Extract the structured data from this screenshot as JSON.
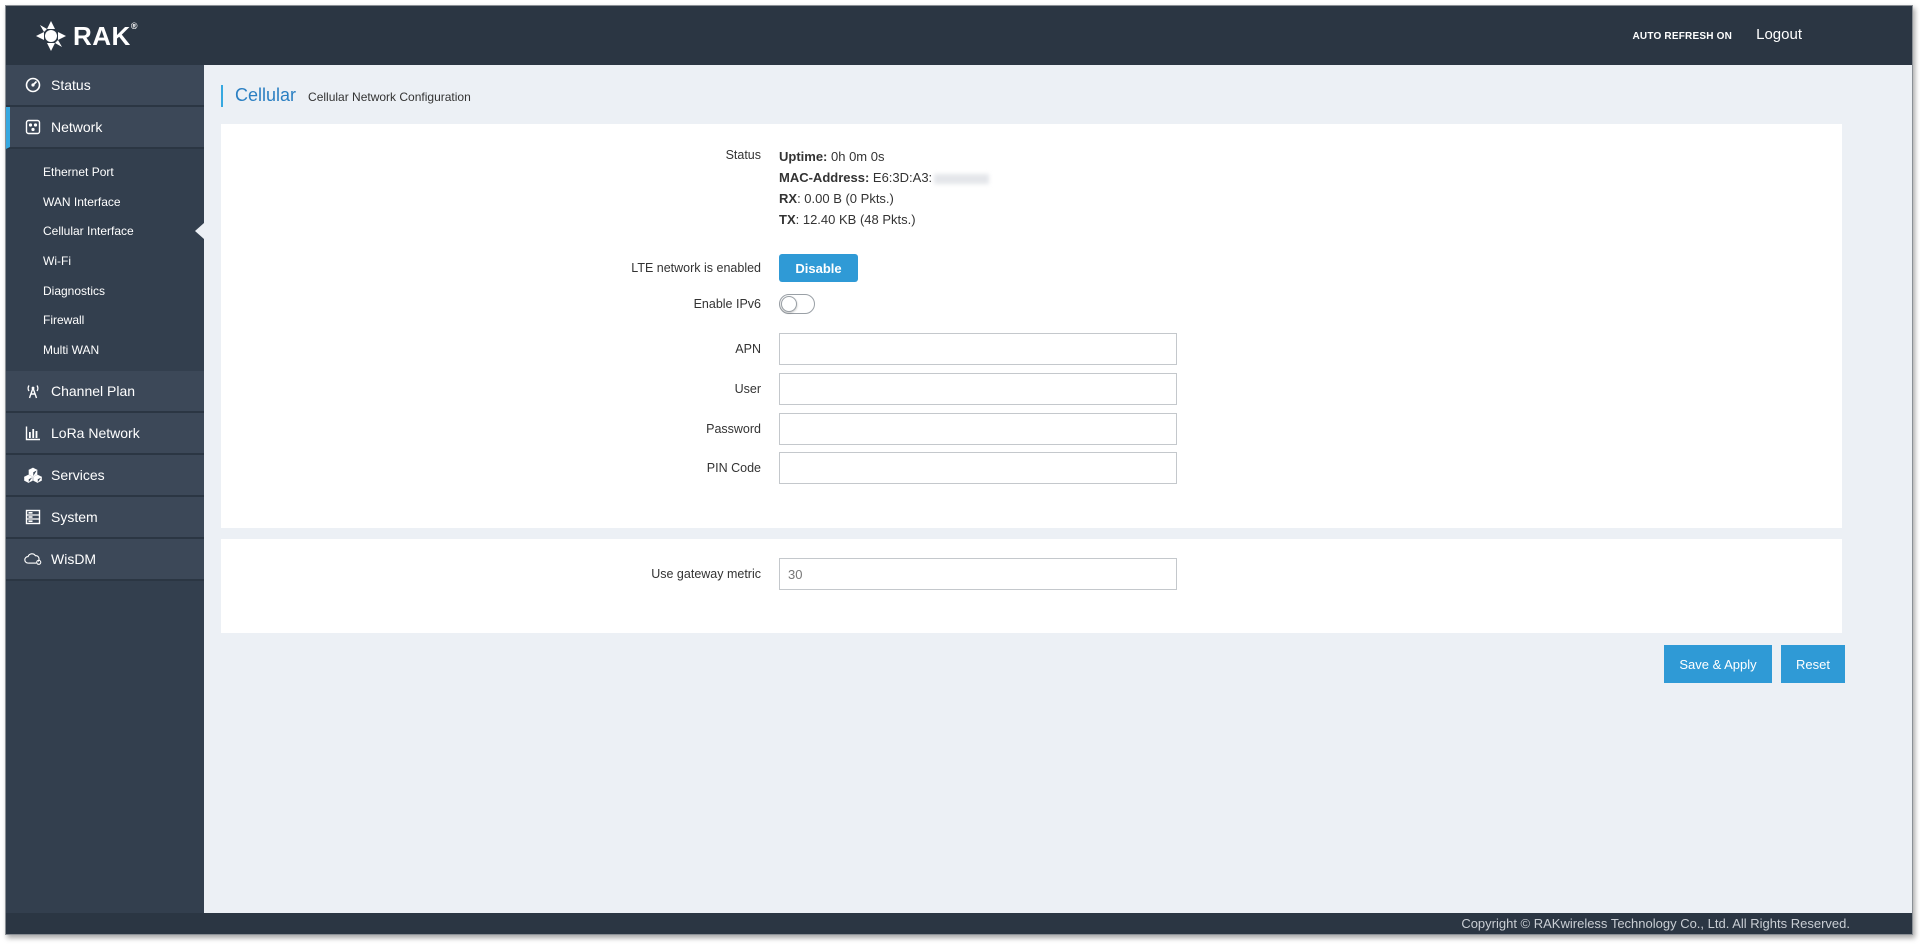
{
  "header": {
    "brand": "RAK",
    "brand_mark": "®",
    "auto_refresh": "AUTO REFRESH ON",
    "logout": "Logout"
  },
  "sidebar": {
    "items": [
      {
        "label": "Status",
        "icon": "dashboard-icon"
      },
      {
        "label": "Network",
        "icon": "network-icon",
        "active": true
      },
      {
        "label": "Channel Plan",
        "icon": "antenna-icon"
      },
      {
        "label": "LoRa Network",
        "icon": "bar-chart-icon"
      },
      {
        "label": "Services",
        "icon": "cubes-icon"
      },
      {
        "label": "System",
        "icon": "server-icon"
      },
      {
        "label": "WisDM",
        "icon": "cloud-icon"
      }
    ],
    "network_sub": [
      "Ethernet Port",
      "WAN Interface",
      "Cellular Interface",
      "Wi-Fi",
      "Diagnostics",
      "Firewall",
      "Multi WAN"
    ],
    "active_sub": "Cellular Interface"
  },
  "page": {
    "title": "Cellular",
    "subtitle": "Cellular Network Configuration"
  },
  "status": {
    "label": "Status",
    "uptime_key": "Uptime:",
    "uptime_val": " 0h 0m 0s",
    "mac_key": "MAC-Address:",
    "mac_val": " E6:3D:A3:",
    "rx_key": "RX",
    "rx_val": ": 0.00 B (0 Pkts.)",
    "tx_key": "TX",
    "tx_val": ": 12.40 KB (48 Pkts.)"
  },
  "form": {
    "lte_label": "LTE network is enabled",
    "lte_button": "Disable",
    "ipv6_label": "Enable IPv6",
    "ipv6_enabled": false,
    "apn_label": "APN",
    "apn_value": "",
    "user_label": "User",
    "user_value": "",
    "password_label": "Password",
    "password_value": "",
    "pin_label": "PIN Code",
    "pin_value": "",
    "metric_label": "Use gateway metric",
    "metric_value": "30"
  },
  "actions": {
    "save": "Save & Apply",
    "reset": "Reset"
  },
  "footer": {
    "copyright": "Copyright © RAKwireless Technology Co., Ltd. All Rights Reserved."
  },
  "colors": {
    "topbar": "#2b3643",
    "sidebar": "#333f4e",
    "accent": "#2f9ad6",
    "title": "#2a7fc2"
  }
}
